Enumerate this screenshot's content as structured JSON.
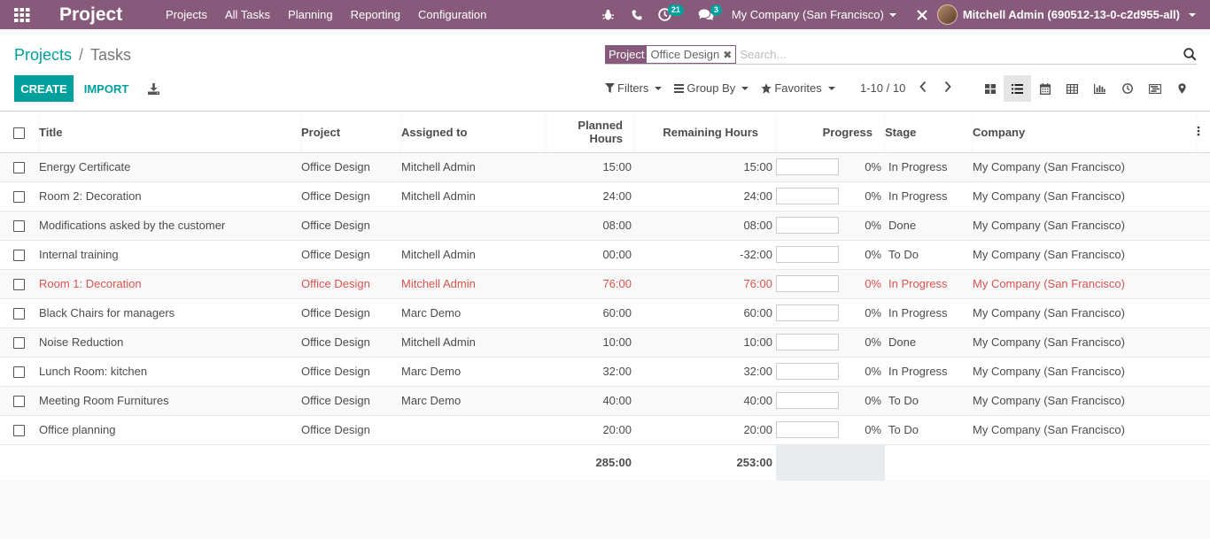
{
  "navbar": {
    "app_name": "Project",
    "menu": [
      "Projects",
      "All Tasks",
      "Planning",
      "Reporting",
      "Configuration"
    ],
    "activity_count": "21",
    "messages_count": "3",
    "company": "My Company (San Francisco)",
    "user": "Mitchell Admin (690512-13-0-c2d955-all)",
    "bg_color": "#875a7b"
  },
  "breadcrumb": {
    "parent": "Projects",
    "separator": "/",
    "current": "Tasks"
  },
  "search": {
    "facet_label": "Project",
    "facet_value": "Office Design",
    "facet_remove": "✖",
    "placeholder": "Search..."
  },
  "buttons": {
    "create": "CREATE",
    "import": "IMPORT"
  },
  "filters": {
    "filters_label": "Filters",
    "group_by_label": "Group By",
    "favorites_label": "Favorites"
  },
  "pager": {
    "value": "1-10 / 10"
  },
  "views": [
    "kanban-view-icon",
    "list-view-icon",
    "calendar-view-icon",
    "pivot-view-icon",
    "graph-view-icon",
    "activity-view-icon",
    "gantt-view-icon",
    "map-view-icon"
  ],
  "table": {
    "headers": {
      "title": "Title",
      "project": "Project",
      "assigned": "Assigned to",
      "planned": "Planned Hours",
      "remaining": "Remaining Hours",
      "progress": "Progress",
      "stage": "Stage",
      "company": "Company"
    },
    "rows": [
      {
        "title": "Energy Certificate",
        "project": "Office Design",
        "assigned": "Mitchell Admin",
        "planned": "15:00",
        "remaining": "15:00",
        "progress": "0%",
        "progress_fill": 0,
        "stage": "In Progress",
        "company": "My Company (San Francisco)",
        "danger": false
      },
      {
        "title": "Room 2: Decoration",
        "project": "Office Design",
        "assigned": "Mitchell Admin",
        "planned": "24:00",
        "remaining": "24:00",
        "progress": "0%",
        "progress_fill": 0,
        "stage": "In Progress",
        "company": "My Company (San Francisco)",
        "danger": false
      },
      {
        "title": "Modifications asked by the customer",
        "project": "Office Design",
        "assigned": "",
        "planned": "08:00",
        "remaining": "08:00",
        "progress": "0%",
        "progress_fill": 0,
        "stage": "Done",
        "company": "My Company (San Francisco)",
        "danger": false
      },
      {
        "title": "Internal training",
        "project": "Office Design",
        "assigned": "Mitchell Admin",
        "planned": "00:00",
        "remaining": "-32:00",
        "progress": "0%",
        "progress_fill": 0,
        "stage": "To Do",
        "company": "My Company (San Francisco)",
        "danger": false
      },
      {
        "title": "Room 1: Decoration",
        "project": "Office Design",
        "assigned": "Mitchell Admin",
        "planned": "76:00",
        "remaining": "76:00",
        "progress": "0%",
        "progress_fill": 0,
        "stage": "In Progress",
        "company": "My Company (San Francisco)",
        "danger": true
      },
      {
        "title": "Black Chairs for managers",
        "project": "Office Design",
        "assigned": "Marc Demo",
        "planned": "60:00",
        "remaining": "60:00",
        "progress": "0%",
        "progress_fill": 0,
        "stage": "In Progress",
        "company": "My Company (San Francisco)",
        "danger": false
      },
      {
        "title": "Noise Reduction",
        "project": "Office Design",
        "assigned": "Mitchell Admin",
        "planned": "10:00",
        "remaining": "10:00",
        "progress": "0%",
        "progress_fill": 0,
        "stage": "Done",
        "company": "My Company (San Francisco)",
        "danger": false
      },
      {
        "title": "Lunch Room: kitchen",
        "project": "Office Design",
        "assigned": "Marc Demo",
        "planned": "32:00",
        "remaining": "32:00",
        "progress": "0%",
        "progress_fill": 0,
        "stage": "In Progress",
        "company": "My Company (San Francisco)",
        "danger": false
      },
      {
        "title": "Meeting Room Furnitures",
        "project": "Office Design",
        "assigned": "Marc Demo",
        "planned": "40:00",
        "remaining": "40:00",
        "progress": "0%",
        "progress_fill": 0,
        "stage": "To Do",
        "company": "My Company (San Francisco)",
        "danger": false
      },
      {
        "title": "Office planning",
        "project": "Office Design",
        "assigned": "",
        "planned": "20:00",
        "remaining": "20:00",
        "progress": "0%",
        "progress_fill": 0,
        "stage": "To Do",
        "company": "My Company (San Francisco)",
        "danger": false
      }
    ],
    "totals": {
      "planned": "285:00",
      "remaining": "253:00"
    }
  },
  "colors": {
    "accent": "#00a09d",
    "brand": "#875a7b",
    "danger": "#d9534f"
  }
}
